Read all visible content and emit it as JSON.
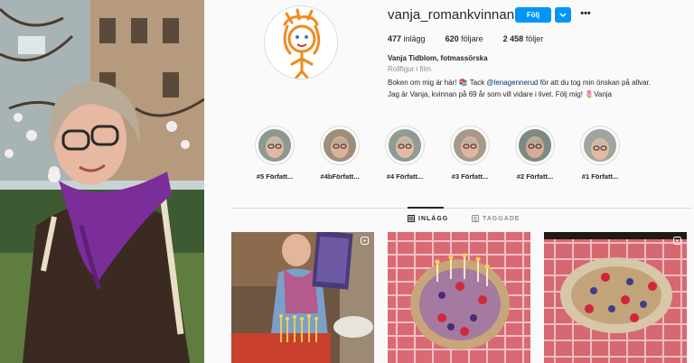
{
  "profile": {
    "username": "vanja_romankvinnan",
    "follow_label": "Följ",
    "more_glyph": "•••",
    "stats": [
      {
        "count": "477",
        "label": "inlägg"
      },
      {
        "count": "620",
        "label": "följare"
      },
      {
        "count": "2 458",
        "label": "följer"
      }
    ],
    "full_name": "Vanja Tidblom, fotmassörska",
    "category": "Rollfigur i film",
    "bio": {
      "line1_before": "Boken om mig är här! 📚 Tack ",
      "mention": "@lenagennerud",
      "line1_after": " för att du tog min önskan på allvar.",
      "line2": "Jag är Vanja, kvinnan på 69 år som vill vidare i livet. Följ mig! 🌷Vanja"
    }
  },
  "highlights": [
    {
      "label": "#5 Författ..."
    },
    {
      "label": "#4bFörfatt..."
    },
    {
      "label": "#4 Författ..."
    },
    {
      "label": "#3 Författ..."
    },
    {
      "label": "#2 Författ..."
    },
    {
      "label": "#1 Författ..."
    }
  ],
  "tabs": {
    "posts": "INLÄGG",
    "tagged": "TAGGADE"
  },
  "colors": {
    "accent": "#0095f6",
    "text": "#262626",
    "muted": "#8e8e8e",
    "border": "#dbdbdb"
  },
  "icons": [
    "chevron-down-icon",
    "more-icon",
    "grid-icon",
    "tag-icon",
    "reel-icon"
  ]
}
